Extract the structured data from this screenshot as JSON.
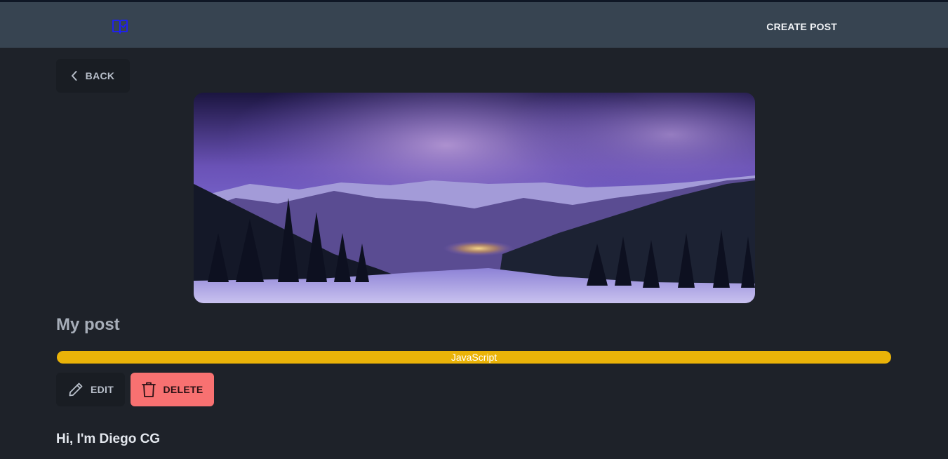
{
  "navbar": {
    "logo_icon": "book-check-icon",
    "create_post_label": "CREATE POST"
  },
  "back_button": {
    "label": "BACK",
    "icon": "chevron-left-icon"
  },
  "post": {
    "image_description_icon": "mountain-night-image",
    "title": "My post",
    "tag": "JavaScript",
    "tag_color": "#eab308",
    "content": "Hi, I'm Diego CG"
  },
  "actions": {
    "edit_label": "EDIT",
    "edit_icon": "pencil-icon",
    "delete_label": "DELETE",
    "delete_icon": "trash-icon",
    "delete_color": "#f87171"
  },
  "colors": {
    "background": "#1e2229",
    "navbar": "#374451",
    "logo": "#1d1dff"
  }
}
